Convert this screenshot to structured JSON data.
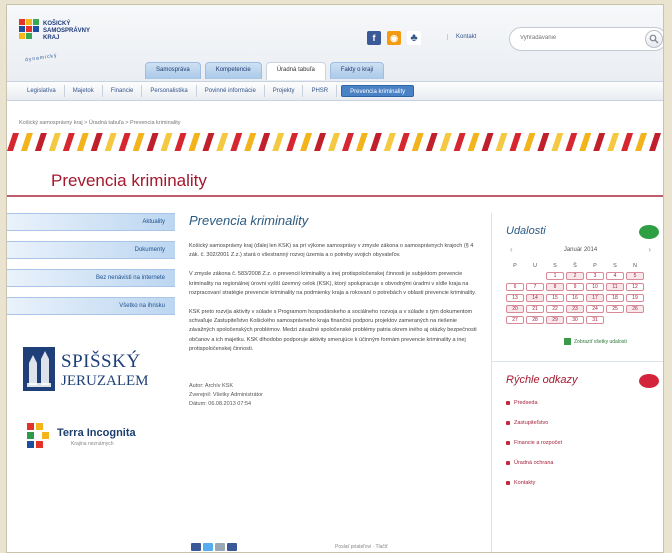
{
  "header": {
    "logo_lines": [
      "KOŠICKÝ",
      "SAMOSPRÁVNY",
      "KRAJ"
    ],
    "logo_tagline": "dynamický ",
    "contact": "Kontakt",
    "search_placeholder": "Vyhľadávanie"
  },
  "tabs": [
    "Samospráva",
    "Kompetencie",
    "Úradná tabuľa",
    "Fakty o kraji"
  ],
  "subnav": [
    "Legislatíva",
    "Majetok",
    "Financie",
    "Personalistika",
    "Povinné informácie",
    "Projekty",
    "PHSR",
    "Prevencia kriminality"
  ],
  "breadcrumb": "Košický samosprávny kraj > Úradná tabuľa > Prevencia kriminality",
  "banner": {
    "title": "Prevencia kriminality"
  },
  "left_nav": [
    "Aktuality",
    "Dokumenty",
    "Bez nenávisti na internete",
    "Všetko na ihrisku"
  ],
  "brands": {
    "spissky_line1": "SPIŠSKÝ",
    "spissky_line2": "JERUZALEM",
    "terra_line1": "Terra Incognita",
    "terra_line2": "Krajina neznámych"
  },
  "article": {
    "title": "Prevencia kriminality",
    "paragraphs": [
      "Košický samosprávny kraj (ďalej len KSK) sa pri výkone samosprávy v zmysle zákona o samosprávnych krajoch (§ 4 zák. č. 302/2001 Z.z.) stará o všestranný rozvoj územia a o potreby svojich obyvateľov.",
      "V zmysle zákona č. 583/2008 Z.z. o prevencii kriminality a inej protispoločenskej činnosti je subjektom prevencie kriminality na regionálnej úrovni vyšší územný celok (KSK), ktorý spolupracuje s obvodnými úradmi v sídle kraja na rozpracovaní stratégie prevencie kriminality na podmienky kraja a rokovaní o potrebách v oblasti prevencie kriminality.",
      "KSK preto rozvíja aktivity v súlade s Programom hospodárskeho a sociálneho rozvoja a v súlade s tým dokumentom schvaľuje Zastupiteľstvo Košického samosprávneho kraja finančnú podporu projektov zameraných na riešenie závažných spoločenských problémov. Medzi závažné spoločenské problémy patria okrem iného aj otázky bezpečnosti občanov a ich majetku. KSK dlhodobo podporuje aktivity smerujúce k účinným formám prevencie kriminality a inej protispoločenskej činnosti."
    ],
    "author": "Autor: Archív KSK",
    "published": "Zverejnil: Všetky Administrátor",
    "date": "Dátum: 06.08.2013 07:54",
    "share_text": "Poslať priateľovi   ·   Tlačiť"
  },
  "events": {
    "title": "Udalosti",
    "month": "Január 2014",
    "day_names": [
      "P",
      "U",
      "S",
      "Š",
      "P",
      "S",
      "N"
    ],
    "weeks": [
      [
        "",
        "",
        "1",
        "2",
        "3",
        "4",
        "5"
      ],
      [
        "6",
        "7",
        "8",
        "9",
        "10",
        "11",
        "12"
      ],
      [
        "13",
        "14",
        "15",
        "16",
        "17",
        "18",
        "19"
      ],
      [
        "20",
        "21",
        "22",
        "23",
        "24",
        "25",
        "26"
      ],
      [
        "27",
        "28",
        "29",
        "30",
        "31",
        "",
        ""
      ]
    ],
    "link": "Zobraziť všetky udalosti"
  },
  "quick_links": {
    "title": "Rýchle odkazy",
    "items": [
      "Predseda",
      "Zastupiteľstvo",
      "Financie a rozpočet",
      "Úradná ochrana",
      "Kontakty"
    ]
  },
  "colors": {
    "accent_red": "#a4182d",
    "nav_blue": "#2a5a82",
    "bubble_green": "#2ea043",
    "bubble_red": "#d4243c"
  }
}
